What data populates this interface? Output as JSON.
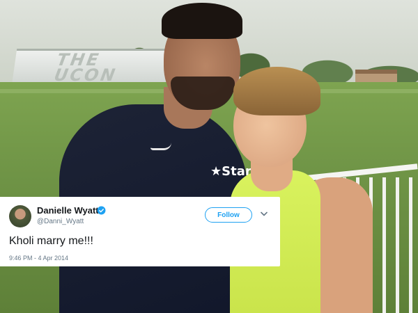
{
  "photo": {
    "stand_text_line1": "THE",
    "stand_text_line2": "UCON",
    "shirt_logo": "★Star"
  },
  "tweet": {
    "user_name": "Danielle Wyatt",
    "user_handle": "@Danni_Wyatt",
    "verified_icon": "verified-badge-icon",
    "follow_label": "Follow",
    "menu_icon": "chevron-down-icon",
    "text": "Kholi marry me!!!",
    "meta": "9:46 PM - 4 Apr 2014"
  },
  "colors": {
    "twitter_blue": "#1da1f2",
    "text_primary": "#14171a",
    "text_secondary": "#657786",
    "card_background": "#ffffff"
  }
}
